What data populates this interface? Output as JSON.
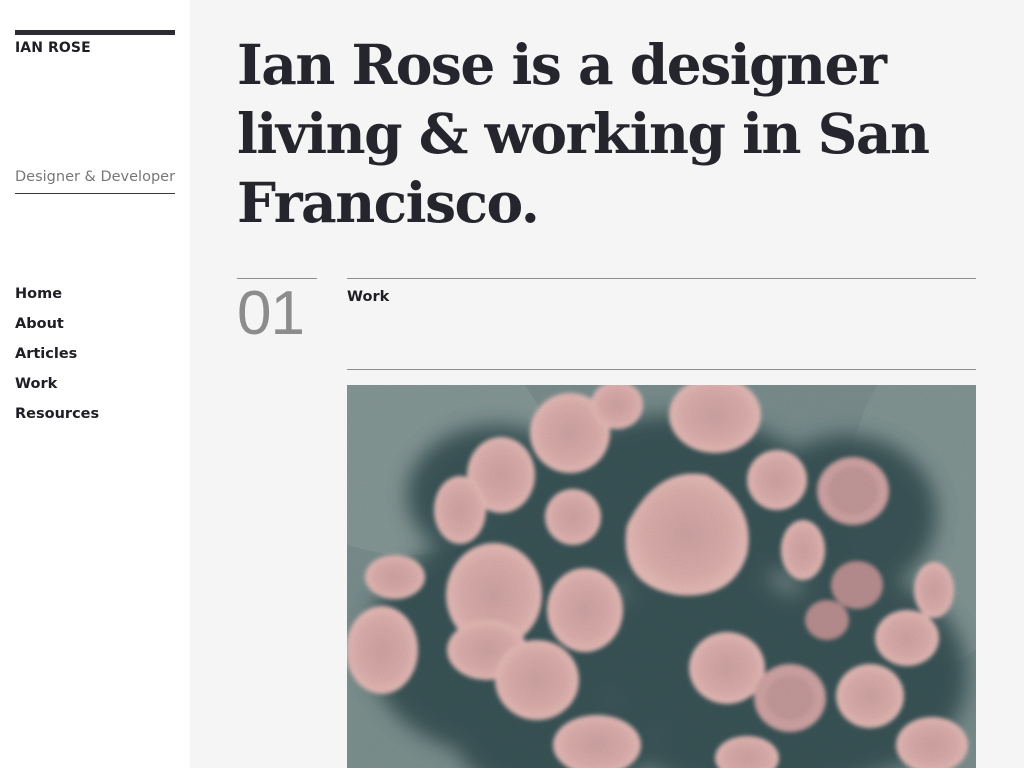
{
  "sidebar": {
    "brand": "IAN ROSE",
    "tagline": "Designer & Developer",
    "nav": [
      {
        "label": "Home"
      },
      {
        "label": "About"
      },
      {
        "label": "Articles"
      },
      {
        "label": "Work"
      },
      {
        "label": "Resources"
      }
    ]
  },
  "main": {
    "headline": "Ian Rose is a designer living & working in San Francisco.",
    "section": {
      "number": "01",
      "title": "Work"
    },
    "image": {
      "subject": "micrograph-virus-particles",
      "colors": {
        "background": "#6f8584",
        "particle": "#d9a9a7",
        "shadow": "#334d51"
      }
    }
  },
  "colors": {
    "sidebar_bg": "#ffffff",
    "main_bg": "#f5f5f5",
    "text_dark": "#25252d",
    "text_muted": "#8c8c8c",
    "rule": "#8f8f8f"
  }
}
